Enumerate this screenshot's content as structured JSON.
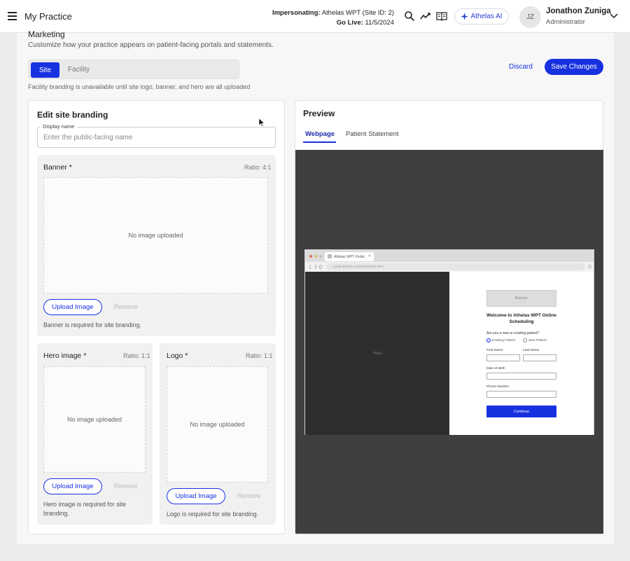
{
  "header": {
    "app_title": "My Practice",
    "impersonating_label": "Impersonating:",
    "impersonating_value": "Athelas WPT (Site ID: 2)",
    "golive_label": "Go Live:",
    "golive_value": "11/5/2024",
    "ai_button": "Athelas AI",
    "icons": [
      "menu-icon",
      "search-icon",
      "trend-icon",
      "book-icon",
      "sparkle-icon",
      "chevron-down-icon"
    ],
    "user": {
      "initials": "JZ",
      "name": "Jonathon Zuniga",
      "role": "Administrator"
    }
  },
  "marketing": {
    "title": "Marketing",
    "subtitle": "Customize how your practice appears on patient-facing portals and statements.",
    "segments": [
      "Site",
      "Facility"
    ],
    "selected_segment": "Site",
    "facility_note": "Facility branding is unavailable until site logo, banner, and hero are all uploaded",
    "discard": "Discard",
    "save": "Save Changes"
  },
  "edit": {
    "title": "Edit site branding",
    "display_name_label": "Display name",
    "display_name_placeholder": "Enter the public-facing name",
    "display_name_value": "",
    "banner": {
      "title": "Banner *",
      "ratio": "Ratio: 4:1",
      "empty": "No image uploaded",
      "upload": "Upload Image",
      "remove": "Remove",
      "note": "Banner is required for site branding."
    },
    "hero": {
      "title": "Hero image *",
      "ratio": "Ratio: 1:1",
      "empty": "No image uploaded",
      "upload": "Upload Image",
      "remove": "Remove",
      "note": "Hero image is required for site branding."
    },
    "logo": {
      "title": "Logo *",
      "ratio": "Ratio: 1:1",
      "empty": "No image uploaded",
      "upload": "Upload Image",
      "remove": "Remove",
      "note": "Logo is required for site branding."
    }
  },
  "preview": {
    "title": "Preview",
    "tabs": [
      "Webpage",
      "Patient Statement"
    ],
    "active_tab": "Webpage",
    "browser": {
      "tab_title": "Athelas WPT Portal",
      "url": "portal.athelas.com/site/Athelas WPT",
      "hero_label": "Hero",
      "banner_label": "Banner",
      "welcome": "Welcome to Athelas WPT Online Scheduling",
      "question": "Are you a new or existing patient?",
      "options": [
        "Existing Patient",
        "New Patient"
      ],
      "selected_option": "Existing Patient",
      "first_name": "First Name",
      "last_name": "Last Name",
      "dob": "Date of Birth",
      "phone": "Phone Number",
      "continue": "Continue"
    }
  },
  "colors": {
    "accent": "#1731e0",
    "stage": "#3f3f3f",
    "hero_bg": "#2e2e2e"
  }
}
